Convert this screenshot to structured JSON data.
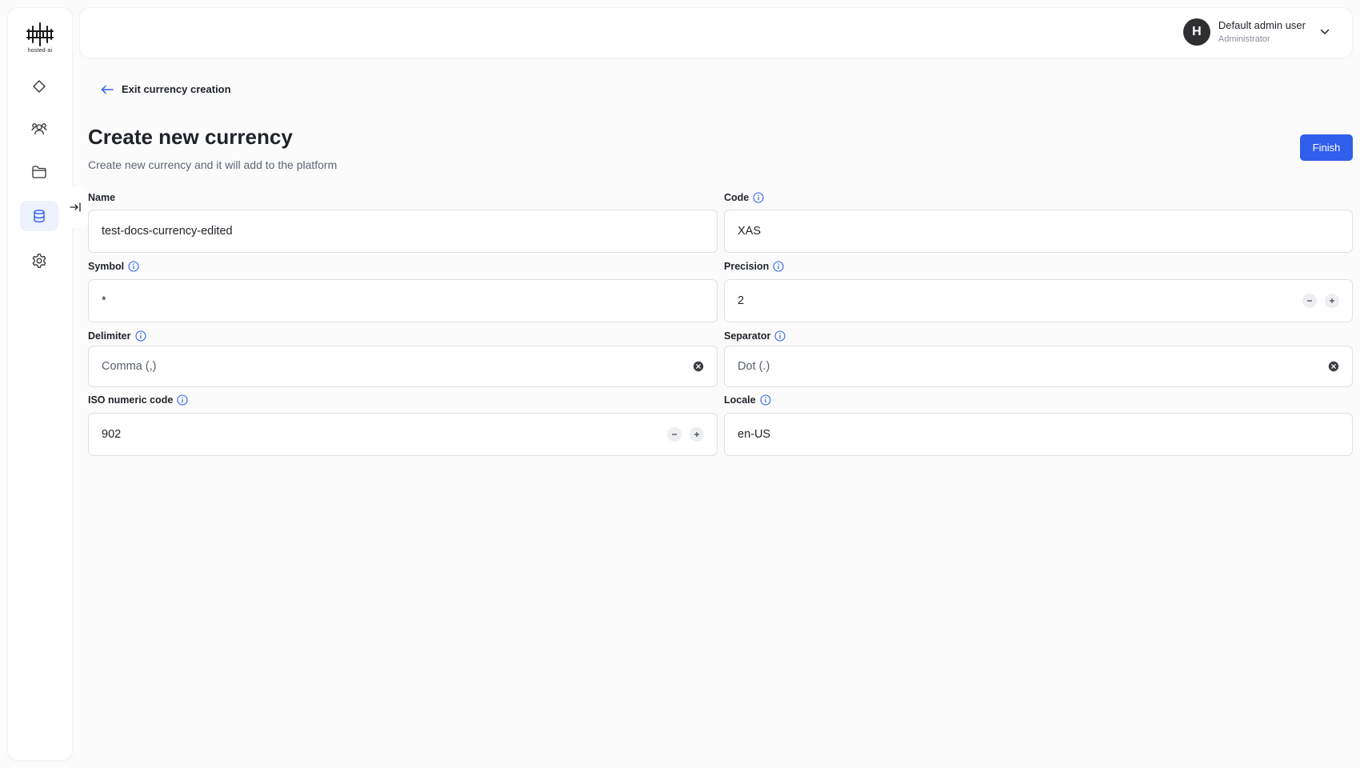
{
  "sidebar": {
    "logo_text": "hosted·ai",
    "items": [
      {
        "name": "dashboard",
        "icon": "diamond-icon"
      },
      {
        "name": "users",
        "icon": "users-icon"
      },
      {
        "name": "projects",
        "icon": "folder-icon"
      },
      {
        "name": "billing",
        "icon": "coins-icon",
        "active": true
      },
      {
        "name": "settings",
        "icon": "gear-icon"
      }
    ],
    "collapse_icon": "expand-sidebar-icon"
  },
  "header": {
    "user": {
      "initial": "H",
      "name": "Default admin user",
      "role": "Administrator"
    }
  },
  "page": {
    "back_label": "Exit currency creation",
    "title": "Create new currency",
    "subtitle": "Create new currency and it will add to the platform",
    "finish_label": "Finish"
  },
  "form": {
    "name": {
      "label": "Name",
      "value": "test-docs-currency-edited"
    },
    "code": {
      "label": "Code",
      "value": "XAS"
    },
    "symbol": {
      "label": "Symbol",
      "value": "*"
    },
    "precision": {
      "label": "Precision",
      "value": "2"
    },
    "delimiter": {
      "label": "Delimiter",
      "value": "Comma (,)"
    },
    "separator": {
      "label": "Separator",
      "value": "Dot (.)"
    },
    "iso_numeric_code": {
      "label": "ISO numeric code",
      "value": "902"
    },
    "locale": {
      "label": "Locale",
      "value": "en-US"
    }
  },
  "colors": {
    "accent": "#2f5fec",
    "active_nav_bg": "#eef2fc",
    "info_icon": "#2f5fec"
  }
}
